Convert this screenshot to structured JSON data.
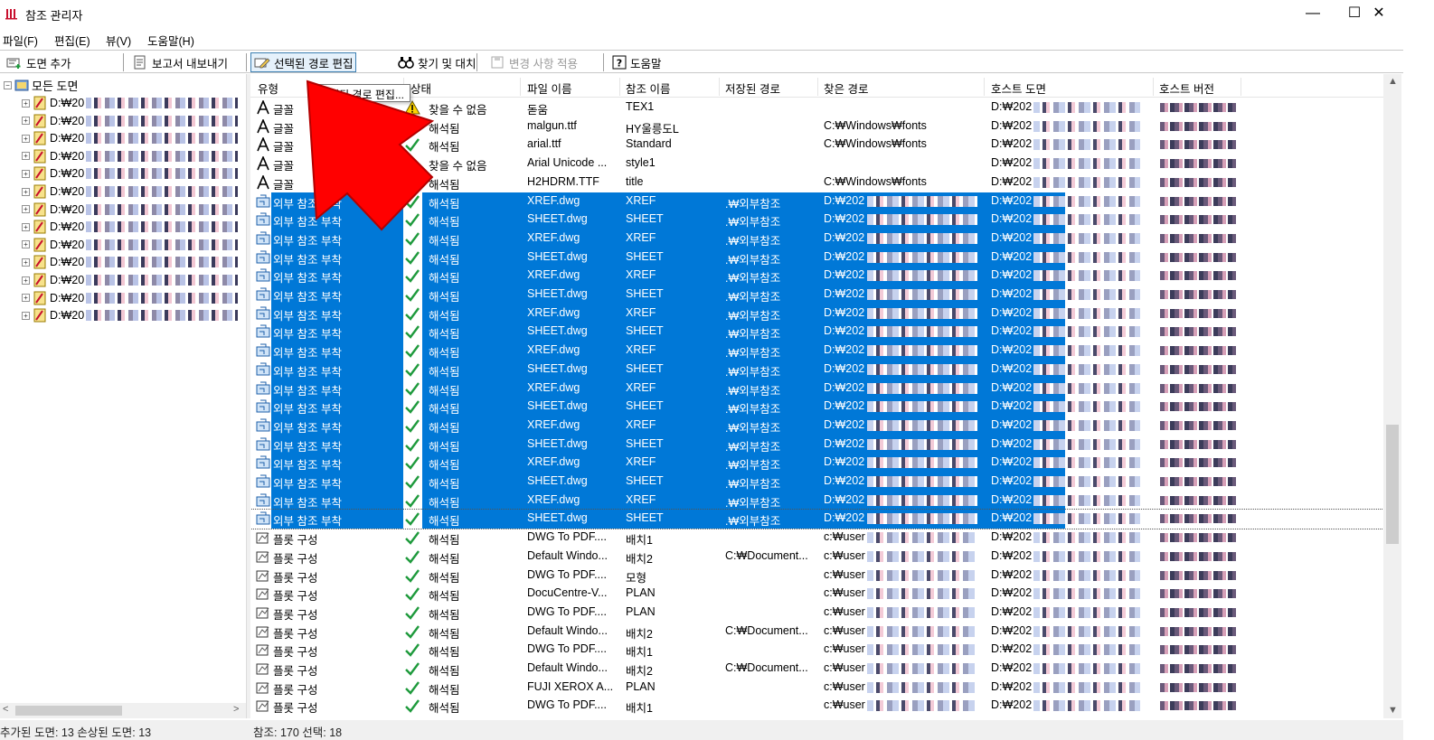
{
  "window": {
    "title": "참조 관리자",
    "minimize": "—",
    "maximize": "☐",
    "close": "✕"
  },
  "menu": [
    "파일(F)",
    "편집(E)",
    "뷰(V)",
    "도움말(H)"
  ],
  "toolbar": {
    "add_drawing": "도면 추가",
    "export_report": "보고서 내보내기",
    "edit_selected_path": "선택된 경로 편집",
    "find_replace": "찾기 및 대치",
    "apply_changes": "변경 사항 적용",
    "help": "도움말"
  },
  "tooltip": "선택된 경로 편집...",
  "tree": {
    "root": "모든 도면",
    "items": [
      "D:₩20",
      "D:₩20",
      "D:₩20",
      "D:₩20",
      "D:₩20",
      "D:₩20",
      "D:₩20",
      "D:₩20",
      "D:₩20",
      "D:₩20",
      "D:₩20",
      "D:₩20",
      "D:₩20"
    ]
  },
  "columns": [
    "유형",
    "상태",
    "파일 이름",
    "참조 이름",
    "저장된 경로",
    "찾은 경로",
    "호스트 도면",
    "호스트 버전"
  ],
  "rows": [
    {
      "type": "글꼴",
      "icon": "font",
      "status": "찾을 수 없음",
      "ok": false,
      "file": "돋움",
      "ref": "TEX1",
      "saved": "",
      "found": "",
      "host": "D:₩202"
    },
    {
      "type": "글꼴",
      "icon": "font",
      "status": "해석됨",
      "ok": true,
      "file": "malgun.ttf",
      "ref": "HY울릉도L",
      "saved": "",
      "found": "C:₩Windows₩fonts",
      "host": "D:₩202"
    },
    {
      "type": "글꼴",
      "icon": "font",
      "status": "해석됨",
      "ok": true,
      "file": "arial.ttf",
      "ref": "Standard",
      "saved": "",
      "found": "C:₩Windows₩fonts",
      "host": "D:₩202"
    },
    {
      "type": "글꼴",
      "icon": "font",
      "status": "찾을 수 없음",
      "ok": false,
      "file": "Arial Unicode ...",
      "ref": "style1",
      "saved": "",
      "found": "",
      "host": "D:₩202"
    },
    {
      "type": "글꼴",
      "icon": "font",
      "status": "해석됨",
      "ok": true,
      "file": "H2HDRM.TTF",
      "ref": "title",
      "saved": "",
      "found": "C:₩Windows₩fonts",
      "host": "D:₩202"
    },
    {
      "type": "외부 참조 부착",
      "icon": "xref",
      "status": "해석됨",
      "ok": true,
      "file": "XREF.dwg",
      "ref": "XREF",
      "saved": ".₩외부참조",
      "found": "D:₩202",
      "host": "D:₩202",
      "sel": true
    },
    {
      "type": "외부 참조 부착",
      "icon": "xref",
      "status": "해석됨",
      "ok": true,
      "file": "SHEET.dwg",
      "ref": "SHEET",
      "saved": ".₩외부참조",
      "found": "D:₩202",
      "host": "D:₩202",
      "sel": true
    },
    {
      "type": "외부 참조 부착",
      "icon": "xref",
      "status": "해석됨",
      "ok": true,
      "file": "XREF.dwg",
      "ref": "XREF",
      "saved": ".₩외부참조",
      "found": "D:₩202",
      "host": "D:₩202",
      "sel": true
    },
    {
      "type": "외부 참조 부착",
      "icon": "xref",
      "status": "해석됨",
      "ok": true,
      "file": "SHEET.dwg",
      "ref": "SHEET",
      "saved": ".₩외부참조",
      "found": "D:₩202",
      "host": "D:₩202",
      "sel": true
    },
    {
      "type": "외부 참조 부착",
      "icon": "xref",
      "status": "해석됨",
      "ok": true,
      "file": "XREF.dwg",
      "ref": "XREF",
      "saved": ".₩외부참조",
      "found": "D:₩202",
      "host": "D:₩202",
      "sel": true
    },
    {
      "type": "외부 참조 부착",
      "icon": "xref",
      "status": "해석됨",
      "ok": true,
      "file": "SHEET.dwg",
      "ref": "SHEET",
      "saved": ".₩외부참조",
      "found": "D:₩202",
      "host": "D:₩202",
      "sel": true
    },
    {
      "type": "외부 참조 부착",
      "icon": "xref",
      "status": "해석됨",
      "ok": true,
      "file": "XREF.dwg",
      "ref": "XREF",
      "saved": ".₩외부참조",
      "found": "D:₩202",
      "host": "D:₩202",
      "sel": true
    },
    {
      "type": "외부 참조 부착",
      "icon": "xref",
      "status": "해석됨",
      "ok": true,
      "file": "SHEET.dwg",
      "ref": "SHEET",
      "saved": ".₩외부참조",
      "found": "D:₩202",
      "host": "D:₩202",
      "sel": true
    },
    {
      "type": "외부 참조 부착",
      "icon": "xref",
      "status": "해석됨",
      "ok": true,
      "file": "XREF.dwg",
      "ref": "XREF",
      "saved": ".₩외부참조",
      "found": "D:₩202",
      "host": "D:₩202",
      "sel": true
    },
    {
      "type": "외부 참조 부착",
      "icon": "xref",
      "status": "해석됨",
      "ok": true,
      "file": "SHEET.dwg",
      "ref": "SHEET",
      "saved": ".₩외부참조",
      "found": "D:₩202",
      "host": "D:₩202",
      "sel": true
    },
    {
      "type": "외부 참조 부착",
      "icon": "xref",
      "status": "해석됨",
      "ok": true,
      "file": "XREF.dwg",
      "ref": "XREF",
      "saved": ".₩외부참조",
      "found": "D:₩202",
      "host": "D:₩202",
      "sel": true
    },
    {
      "type": "외부 참조 부착",
      "icon": "xref",
      "status": "해석됨",
      "ok": true,
      "file": "SHEET.dwg",
      "ref": "SHEET",
      "saved": ".₩외부참조",
      "found": "D:₩202",
      "host": "D:₩202",
      "sel": true
    },
    {
      "type": "외부 참조 부착",
      "icon": "xref",
      "status": "해석됨",
      "ok": true,
      "file": "XREF.dwg",
      "ref": "XREF",
      "saved": ".₩외부참조",
      "found": "D:₩202",
      "host": "D:₩202",
      "sel": true
    },
    {
      "type": "외부 참조 부착",
      "icon": "xref",
      "status": "해석됨",
      "ok": true,
      "file": "SHEET.dwg",
      "ref": "SHEET",
      "saved": ".₩외부참조",
      "found": "D:₩202",
      "host": "D:₩202",
      "sel": true
    },
    {
      "type": "외부 참조 부착",
      "icon": "xref",
      "status": "해석됨",
      "ok": true,
      "file": "XREF.dwg",
      "ref": "XREF",
      "saved": ".₩외부참조",
      "found": "D:₩202",
      "host": "D:₩202",
      "sel": true
    },
    {
      "type": "외부 참조 부착",
      "icon": "xref",
      "status": "해석됨",
      "ok": true,
      "file": "SHEET.dwg",
      "ref": "SHEET",
      "saved": ".₩외부참조",
      "found": "D:₩202",
      "host": "D:₩202",
      "sel": true
    },
    {
      "type": "외부 참조 부착",
      "icon": "xref",
      "status": "해석됨",
      "ok": true,
      "file": "XREF.dwg",
      "ref": "XREF",
      "saved": ".₩외부참조",
      "found": "D:₩202",
      "host": "D:₩202",
      "sel": true
    },
    {
      "type": "외부 참조 부착",
      "icon": "xref",
      "status": "해석됨",
      "ok": true,
      "file": "SHEET.dwg",
      "ref": "SHEET",
      "saved": ".₩외부참조",
      "found": "D:₩202",
      "host": "D:₩202",
      "sel": true,
      "focus": true
    },
    {
      "type": "플롯 구성",
      "icon": "plot",
      "status": "해석됨",
      "ok": true,
      "file": "DWG To PDF....",
      "ref": "배치1",
      "saved": "",
      "found": "c:₩user",
      "host": "D:₩202"
    },
    {
      "type": "플롯 구성",
      "icon": "plot",
      "status": "해석됨",
      "ok": true,
      "file": "Default Windo...",
      "ref": "배치2",
      "saved": "C:₩Document...",
      "found": "c:₩user",
      "host": "D:₩202"
    },
    {
      "type": "플롯 구성",
      "icon": "plot",
      "status": "해석됨",
      "ok": true,
      "file": "DWG To PDF....",
      "ref": "모형",
      "saved": "",
      "found": "c:₩user",
      "host": "D:₩202"
    },
    {
      "type": "플롯 구성",
      "icon": "plot",
      "status": "해석됨",
      "ok": true,
      "file": "DocuCentre-V...",
      "ref": "PLAN",
      "saved": "",
      "found": "c:₩user",
      "host": "D:₩202"
    },
    {
      "type": "플롯 구성",
      "icon": "plot",
      "status": "해석됨",
      "ok": true,
      "file": "DWG To PDF....",
      "ref": "PLAN",
      "saved": "",
      "found": "c:₩user",
      "host": "D:₩202"
    },
    {
      "type": "플롯 구성",
      "icon": "plot",
      "status": "해석됨",
      "ok": true,
      "file": "Default Windo...",
      "ref": "배치2",
      "saved": "C:₩Document...",
      "found": "c:₩user",
      "host": "D:₩202"
    },
    {
      "type": "플롯 구성",
      "icon": "plot",
      "status": "해석됨",
      "ok": true,
      "file": "DWG To PDF....",
      "ref": "배치1",
      "saved": "",
      "found": "c:₩user",
      "host": "D:₩202"
    },
    {
      "type": "플롯 구성",
      "icon": "plot",
      "status": "해석됨",
      "ok": true,
      "file": "Default Windo...",
      "ref": "배치2",
      "saved": "C:₩Document...",
      "found": "c:₩user",
      "host": "D:₩202"
    },
    {
      "type": "플롯 구성",
      "icon": "plot",
      "status": "해석됨",
      "ok": true,
      "file": "FUJI XEROX A...",
      "ref": "PLAN",
      "saved": "",
      "found": "c:₩user",
      "host": "D:₩202"
    },
    {
      "type": "플롯 구성",
      "icon": "plot",
      "status": "해석됨",
      "ok": true,
      "file": "DWG To PDF....",
      "ref": "배치1",
      "saved": "",
      "found": "c:₩user",
      "host": "D:₩202"
    }
  ],
  "status": {
    "left": "추가된 도면: 13    손상된 도면: 13",
    "right": "참조: 170    선택: 18"
  },
  "colors": {
    "selection": "#0078d7",
    "arrow": "#ff0000",
    "check": "#1e9a3c",
    "warning": "#ffd400"
  }
}
